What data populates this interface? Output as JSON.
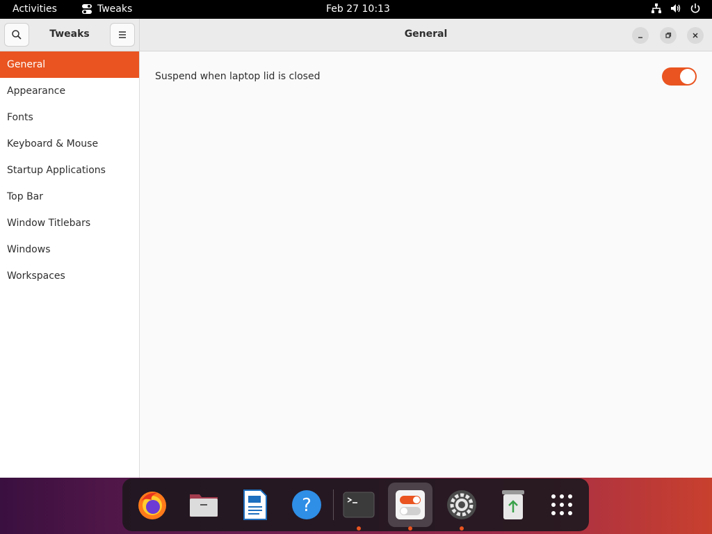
{
  "topbar": {
    "activities": "Activities",
    "app_name": "Tweaks",
    "clock": "Feb 27  10:13",
    "tray_icons": [
      "network-icon",
      "volume-icon",
      "power-icon"
    ]
  },
  "window": {
    "sidebar_title": "Tweaks",
    "main_title": "General",
    "sidebar_items": [
      {
        "label": "General",
        "active": true
      },
      {
        "label": "Appearance",
        "active": false
      },
      {
        "label": "Fonts",
        "active": false
      },
      {
        "label": "Keyboard & Mouse",
        "active": false
      },
      {
        "label": "Startup Applications",
        "active": false
      },
      {
        "label": "Top Bar",
        "active": false
      },
      {
        "label": "Window Titlebars",
        "active": false
      },
      {
        "label": "Windows",
        "active": false
      },
      {
        "label": "Workspaces",
        "active": false
      }
    ],
    "settings": [
      {
        "label": "Suspend when laptop lid is closed",
        "enabled": true
      }
    ]
  },
  "dock": {
    "items": [
      {
        "name": "firefox-icon",
        "running": false
      },
      {
        "name": "files-icon",
        "running": false
      },
      {
        "name": "writer-icon",
        "running": false
      },
      {
        "name": "help-icon",
        "running": false
      },
      {
        "name": "terminal-icon",
        "running": true
      },
      {
        "name": "tweaks-icon",
        "running": true,
        "active": true
      },
      {
        "name": "settings-icon",
        "running": true
      },
      {
        "name": "trash-icon",
        "running": false
      },
      {
        "name": "app-grid-icon",
        "running": false
      }
    ]
  },
  "colors": {
    "accent": "#e95420",
    "topbar": "#000000",
    "sidebar_bg": "#ffffff",
    "content_bg": "#fafafa"
  }
}
